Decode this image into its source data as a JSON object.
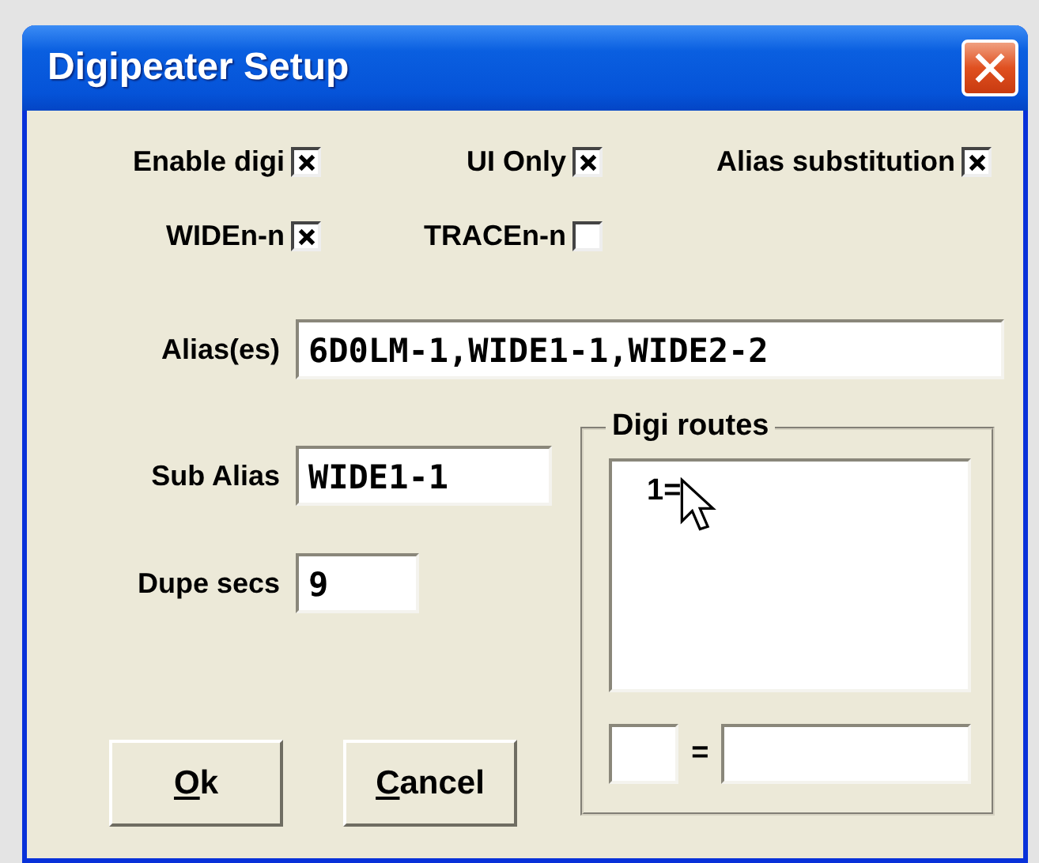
{
  "window": {
    "title": "Digipeater Setup"
  },
  "checkboxes": [
    {
      "label": "Enable digi",
      "checked": true
    },
    {
      "label": "UI Only",
      "checked": true
    },
    {
      "label": "Alias substitution",
      "checked": true
    },
    {
      "label": "WIDEn-n",
      "checked": true
    },
    {
      "label": "TRACEn-n",
      "checked": false
    }
  ],
  "alias": {
    "label": "Alias(es)",
    "value": "6D0LM-1,WIDE1-1,WIDE2-2"
  },
  "sub_alias": {
    "label": "Sub Alias",
    "value": "WIDE1-1"
  },
  "dupe_secs": {
    "label": "Dupe secs",
    "value": "9"
  },
  "digi_routes": {
    "title": "Digi routes",
    "items": [
      "1="
    ],
    "separator": "="
  },
  "buttons": [
    {
      "label": "Ok"
    },
    {
      "label": "Cancel"
    }
  ]
}
